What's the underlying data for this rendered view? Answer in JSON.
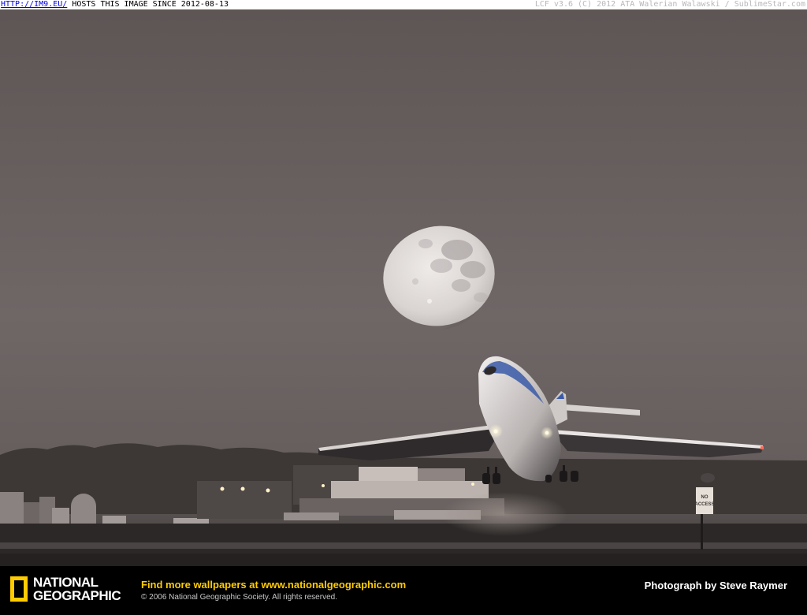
{
  "host_banner": {
    "link_text": "HTTP://IM9.EU/",
    "hosts_text": " HOSTS THIS IMAGE SINCE 2012-08-13",
    "right_text": "LCF v3.6 (C) 2012 ATA Walerian Walawski / SublimeStar.com"
  },
  "photo": {
    "sign_text": "NO ACCESS"
  },
  "caption": {
    "logo_line1": "NATIONAL",
    "logo_line2": "GEOGRAPHIC",
    "promo_prefix": "Find more wallpapers at ",
    "promo_link": "www.nationalgeographic.com",
    "copyright": "© 2006 National Geographic Society. All rights reserved.",
    "credit": "Photograph by Steve Raymer"
  },
  "colors": {
    "brand_yellow": "#ffcc00",
    "sky": "#6f6766",
    "link_blue": "#0000ee"
  }
}
